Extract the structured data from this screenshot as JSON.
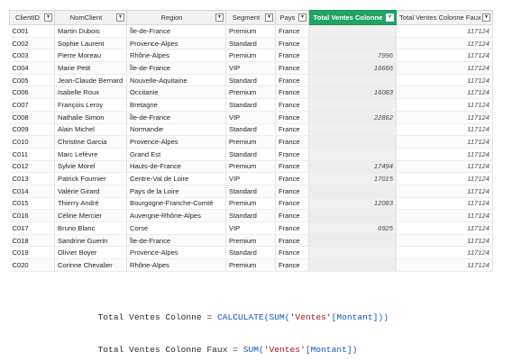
{
  "table": {
    "headers": [
      {
        "key": "id",
        "label": "ClientID"
      },
      {
        "key": "name",
        "label": "NomClient"
      },
      {
        "key": "region",
        "label": "Region"
      },
      {
        "key": "segment",
        "label": "Segment"
      },
      {
        "key": "country",
        "label": "Pays"
      },
      {
        "key": "total",
        "label": "Total Ventes Colonne"
      },
      {
        "key": "totalfaux",
        "label": "Total Ventes Colonne Faux"
      }
    ],
    "filter_glyph": "▾",
    "rows": [
      {
        "id": "C001",
        "name": "Martin Dubois",
        "region": "Île-de-France",
        "segment": "Premium",
        "country": "France",
        "total": "",
        "totalfaux": "117124"
      },
      {
        "id": "C002",
        "name": "Sophie Laurent",
        "region": "Provence-Alpes",
        "segment": "Standard",
        "country": "France",
        "total": "",
        "totalfaux": "117124"
      },
      {
        "id": "C003",
        "name": "Pierre Moreau",
        "region": "Rhône-Alpes",
        "segment": "Premium",
        "country": "France",
        "total": "7996",
        "totalfaux": "117124"
      },
      {
        "id": "C004",
        "name": "Marie Petit",
        "region": "Île-de-France",
        "segment": "VIP",
        "country": "France",
        "total": "16666",
        "totalfaux": "117124"
      },
      {
        "id": "C005",
        "name": "Jean-Claude Bernard",
        "region": "Nouvelle-Aquitaine",
        "segment": "Standard",
        "country": "France",
        "total": "",
        "totalfaux": "117124"
      },
      {
        "id": "C006",
        "name": "Isabelle Roux",
        "region": "Occitanie",
        "segment": "Premium",
        "country": "France",
        "total": "16083",
        "totalfaux": "117124"
      },
      {
        "id": "C007",
        "name": "François Leroy",
        "region": "Bretagne",
        "segment": "Standard",
        "country": "France",
        "total": "",
        "totalfaux": "117124"
      },
      {
        "id": "C008",
        "name": "Nathalie Simon",
        "region": "Île-de-France",
        "segment": "VIP",
        "country": "France",
        "total": "22862",
        "totalfaux": "117124"
      },
      {
        "id": "C009",
        "name": "Alain Michel",
        "region": "Normandie",
        "segment": "Standard",
        "country": "France",
        "total": "",
        "totalfaux": "117124"
      },
      {
        "id": "C010",
        "name": "Christine Garcia",
        "region": "Provence-Alpes",
        "segment": "Premium",
        "country": "France",
        "total": "",
        "totalfaux": "117124"
      },
      {
        "id": "C011",
        "name": "Marc Lefèvre",
        "region": "Grand Est",
        "segment": "Standard",
        "country": "France",
        "total": "",
        "totalfaux": "117124"
      },
      {
        "id": "C012",
        "name": "Sylvie Morel",
        "region": "Hauts-de-France",
        "segment": "Premium",
        "country": "France",
        "total": "17494",
        "totalfaux": "117124"
      },
      {
        "id": "C013",
        "name": "Patrick Fournier",
        "region": "Centre-Val de Loire",
        "segment": "VIP",
        "country": "France",
        "total": "17015",
        "totalfaux": "117124"
      },
      {
        "id": "C014",
        "name": "Valérie Girard",
        "region": "Pays de la Loire",
        "segment": "Standard",
        "country": "France",
        "total": "",
        "totalfaux": "117124"
      },
      {
        "id": "C015",
        "name": "Thierry André",
        "region": "Bourgogne-Franche-Comté",
        "segment": "Premium",
        "country": "France",
        "total": "12083",
        "totalfaux": "117124"
      },
      {
        "id": "C016",
        "name": "Céline Mercier",
        "region": "Auvergne-Rhône-Alpes",
        "segment": "Standard",
        "country": "France",
        "total": "",
        "totalfaux": "117124"
      },
      {
        "id": "C017",
        "name": "Bruno Blanc",
        "region": "Corse",
        "segment": "VIP",
        "country": "France",
        "total": "6925",
        "totalfaux": "117124"
      },
      {
        "id": "C018",
        "name": "Sandrine Guerin",
        "region": "Île-de-France",
        "segment": "Premium",
        "country": "France",
        "total": "",
        "totalfaux": "117124"
      },
      {
        "id": "C019",
        "name": "Olivier Boyer",
        "region": "Provence-Alpes",
        "segment": "Standard",
        "country": "France",
        "total": "",
        "totalfaux": "117124"
      },
      {
        "id": "C020",
        "name": "Corinne Chevalier",
        "region": "Rhône-Alpes",
        "segment": "Premium",
        "country": "France",
        "total": "",
        "totalfaux": "117124"
      }
    ]
  },
  "formulas": [
    {
      "name": "Total Ventes Colonne",
      "eq": " = ",
      "fn_open": "CALCULATE(SUM(",
      "table": "'Ventes'",
      "col": "[Montant]",
      "close": "))"
    },
    {
      "name": "Total Ventes Colonne Faux",
      "eq": " = ",
      "fn_open": "SUM(",
      "table": "'Ventes'",
      "col": "[Montant]",
      "close": ")"
    }
  ],
  "colors": {
    "highlight_header": "#21a366"
  }
}
